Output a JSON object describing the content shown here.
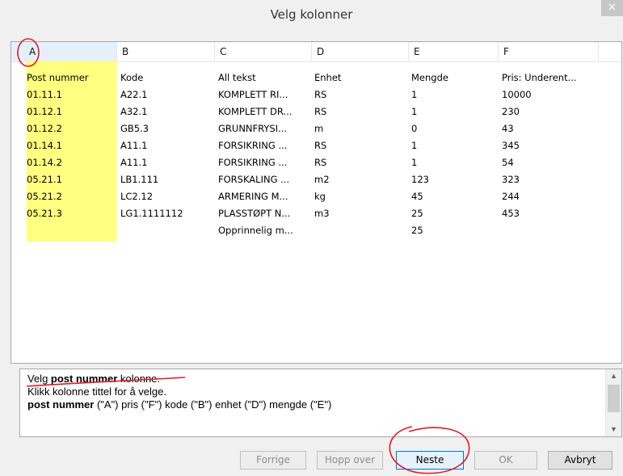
{
  "window": {
    "title": "Velg kolonner",
    "close_label": "×"
  },
  "grid": {
    "columns": [
      "A",
      "B",
      "C",
      "D",
      "E",
      "F"
    ],
    "rows": [
      [
        "Post nummer",
        "Kode",
        "All tekst",
        "Enhet",
        "Mengde",
        "Pris: Underent..."
      ],
      [
        "01.11.1",
        "A22.1",
        "KOMPLETT RI...",
        "RS",
        "1",
        "10000"
      ],
      [
        "01.12.1",
        "A32.1",
        "KOMPLETT DR...",
        "RS",
        "1",
        "230"
      ],
      [
        "01.12.2",
        "GB5.3",
        "GRUNNFRYSI...",
        "m",
        "0",
        "43"
      ],
      [
        "01.14.1",
        "A11.1",
        "FORSIKRING ...",
        "RS",
        "1",
        "345"
      ],
      [
        "01.14.2",
        "A11.1",
        "FORSIKRING ...",
        "RS",
        "1",
        "54"
      ],
      [
        "05.21.1",
        "LB1.111",
        "FORSKALING ...",
        "m2",
        "123",
        "323"
      ],
      [
        "05.21.2",
        "LC2.12",
        "ARMERING M...",
        "kg",
        "45",
        "244"
      ],
      [
        "05.21.3",
        "LG1.1111112",
        "PLASSTØPT N...",
        "m3",
        "25",
        "453"
      ],
      [
        "",
        "",
        "Opprinnelig m...",
        "",
        "25",
        ""
      ]
    ],
    "highlight_color": "#ffff80"
  },
  "message": {
    "line1_prefix": "Velg ",
    "line1_bold": "post nummer",
    "line1_suffix": " kolonne.",
    "line2": "Klikk kolonne tittel for å velge.",
    "line3_bold": "post nummer",
    "line3_rest": " (\"A\")  pris (\"F\")  kode (\"B\")  enhet (\"D\")  mengde (\"E\")"
  },
  "buttons": {
    "prev": "Forrige",
    "skip": "Hopp over",
    "next": "Neste",
    "ok": "OK",
    "cancel": "Avbryt"
  },
  "icons": {
    "close": "close-icon",
    "scroll_up": "chevron-up-icon",
    "scroll_down": "chevron-down-icon"
  },
  "colors": {
    "annotation": "#e01b24",
    "default_button_border": "#0078d7"
  }
}
